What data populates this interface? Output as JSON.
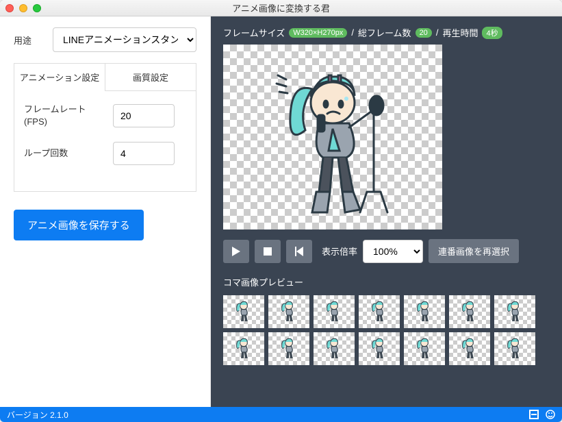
{
  "window": {
    "title": "アニメ画像に変換する君"
  },
  "left": {
    "purpose_label": "用途",
    "purpose_value": "LINEアニメーションスタンプ",
    "tabs": {
      "anim": "アニメーション設定",
      "quality": "画質設定"
    },
    "fps_label": "フレームレート\n(FPS)",
    "fps_value": "20",
    "loop_label": "ループ回数",
    "loop_value": "4",
    "save_label": "アニメ画像を保存する"
  },
  "right": {
    "framesize_label": "フレームサイズ",
    "framesize_value": "W320×H270px",
    "totalframes_label": "総フレーム数",
    "totalframes_value": "20",
    "playtime_label": "再生時間",
    "playtime_value": "4秒",
    "zoom_label": "表示倍率",
    "zoom_value": "100%",
    "reselect_label": "連番画像を再選択",
    "thumbs_label": "コマ画像プレビュー",
    "sep": "/"
  },
  "footer": {
    "version": "バージョン 2.1.0"
  },
  "colors": {
    "accent": "#0d7cf2",
    "dark": "#3a4452"
  }
}
